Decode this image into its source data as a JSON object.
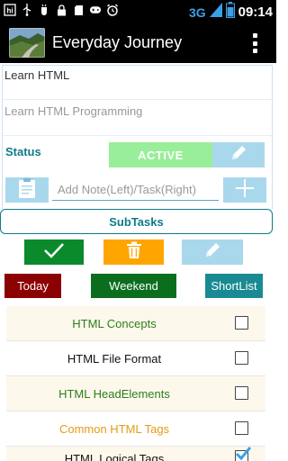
{
  "status_bar": {
    "icons": [
      "hi-app-icon",
      "usb-icon",
      "usb-debug-icon",
      "lock-icon",
      "sd-card-icon",
      "gamepad-icon",
      "alarm-icon"
    ],
    "network": "3G",
    "time": "09:14"
  },
  "action_bar": {
    "title": "Everyday Journey"
  },
  "form": {
    "title_value": "Learn HTML",
    "description_value": "Learn HTML Programming",
    "status_label": "Status",
    "status_value": "ACTIVE",
    "note_placeholder": "Add Note(Left)/Task(Right)",
    "subtasks_label": "SubTasks"
  },
  "filters": {
    "today": "Today",
    "weekend": "Weekend",
    "shortlist": "ShortList"
  },
  "tasks": [
    {
      "label": "HTML Concepts",
      "color": "#2e7d1a",
      "checked": false
    },
    {
      "label": "HTML File Format",
      "color": "#111111",
      "checked": false
    },
    {
      "label": "HTML HeadElements",
      "color": "#2e7d1a",
      "checked": false
    },
    {
      "label": "Common HTML Tags",
      "color": "#e89a12",
      "checked": false
    },
    {
      "label": "HTML Logical Tags",
      "color": "#111111",
      "checked": true
    }
  ],
  "colors": {
    "status_active": "#99ee99",
    "accent_teal": "#0f7b8a",
    "light_blue": "#a9d8ec",
    "done_green": "#0b8a2b",
    "delete_orange": "#ffa500",
    "today_red": "#8b0000"
  }
}
